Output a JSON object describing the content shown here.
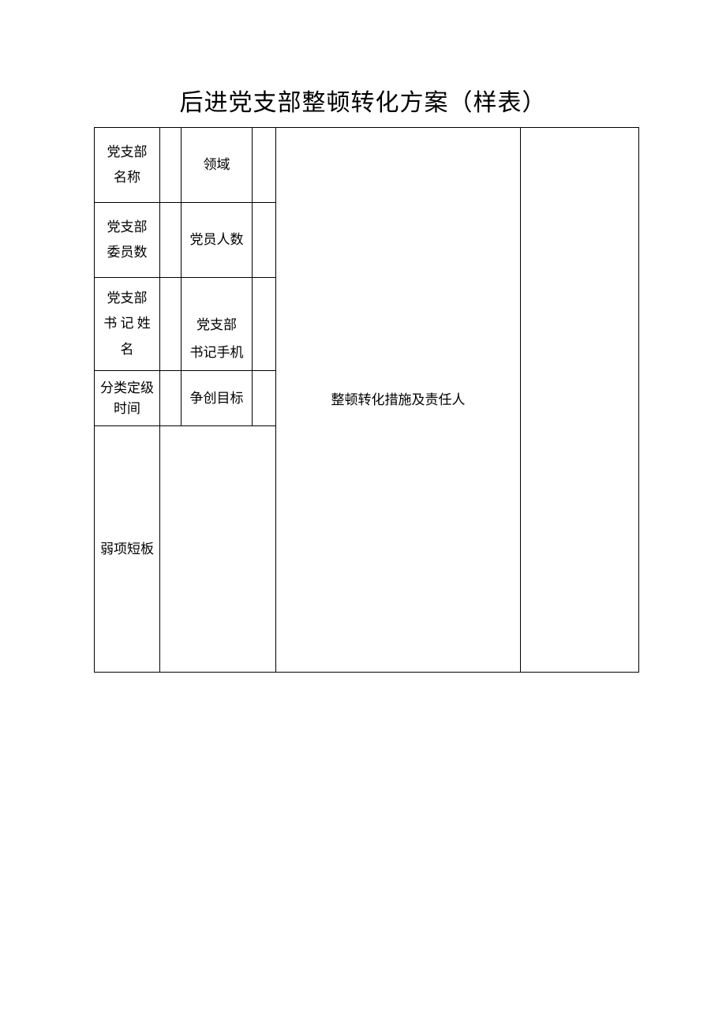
{
  "title": "后进党支部整顿转化方案（样表）",
  "rows": {
    "r1": {
      "label1": "党支部\n名称",
      "label2": "领域"
    },
    "r2": {
      "label1": "党支部\n委员数",
      "label2": "党员人数"
    },
    "r3": {
      "label1": "党支部\n书 记 姓\n名",
      "label2": "党支部\n书记手机"
    },
    "r4": {
      "label1": "分类定级\n时间",
      "label2": "争创目标"
    },
    "r5": {
      "label1": "弱项短板"
    }
  },
  "merged": {
    "measures": "整顿转化措施及责任人"
  }
}
